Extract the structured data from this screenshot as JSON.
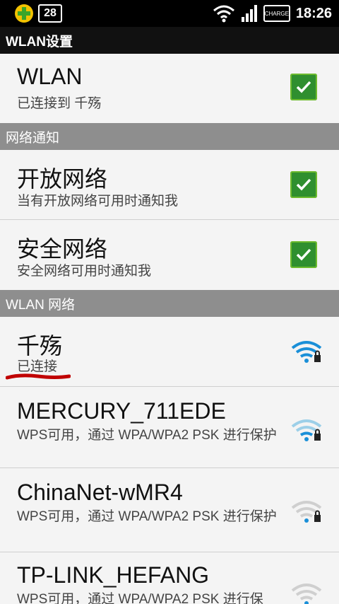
{
  "status_bar": {
    "badge_text": "28",
    "charge_label": "CHARGE",
    "time": "18:26"
  },
  "title_bar": {
    "title": "WLAN设置"
  },
  "wlan": {
    "title": "WLAN",
    "status": "已连接到 千殇",
    "checked": true
  },
  "section_notify": {
    "label": "网络通知"
  },
  "open_network": {
    "title": "开放网络",
    "description": "当有开放网络可用时通知我",
    "checked": true
  },
  "secure_network": {
    "title": "安全网络",
    "description": "安全网络可用时通知我",
    "checked": true
  },
  "section_networks": {
    "label": "WLAN 网络"
  },
  "networks": [
    {
      "ssid": "千殇",
      "status": "已连接",
      "signal_color": "#1a8fd8",
      "icon": "wifi-lock-icon"
    },
    {
      "ssid": "MERCURY_711EDE",
      "status": "WPS可用，通过 WPA/WPA2 PSK 进行保护",
      "signal_color": "#9ccfe8",
      "icon": "wifi-lock-icon"
    },
    {
      "ssid": "ChinaNet-wMR4",
      "status": "WPS可用，通过 WPA/WPA2 PSK 进行保护",
      "signal_color": "#bbbbbb",
      "icon": "wifi-lock-icon"
    },
    {
      "ssid": "TP-LINK_HEFANG",
      "status": "WPS可用，通过 WPA/WPA2 PSK 进行保",
      "signal_color": "#bbbbbb",
      "icon": "wifi-lock-icon"
    }
  ],
  "colors": {
    "check_green": "#2f8f2f",
    "section_gray": "#8e8e8e",
    "background": "#f4f4f4",
    "underline_red": "#c00000"
  }
}
